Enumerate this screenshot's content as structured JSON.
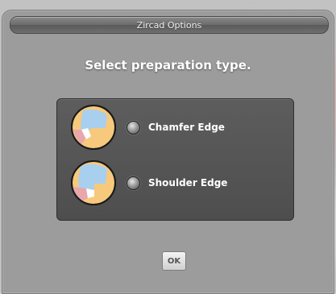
{
  "dialog": {
    "title": "Zircad Options",
    "heading": "Select preparation type.",
    "options": [
      {
        "label": "Chamfer Edge",
        "icon": "chamfer-preview-icon",
        "selected": false
      },
      {
        "label": "Shoulder Edge",
        "icon": "shoulder-preview-icon",
        "selected": false
      }
    ],
    "ok_label": "OK"
  },
  "colors": {
    "dialog_bg": "#9c9c9c",
    "panel_bg": "#555555",
    "thumb_yellow": "#f7c97c",
    "thumb_blue": "#a9cfee",
    "thumb_pink": "#e8a6ad"
  }
}
